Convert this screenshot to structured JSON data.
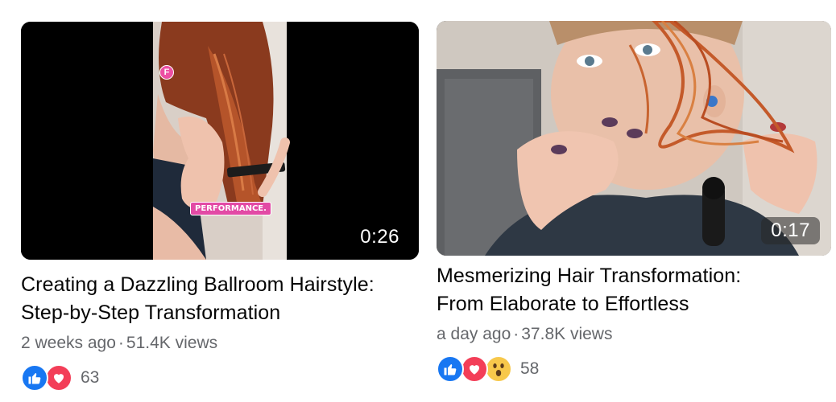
{
  "videos": [
    {
      "duration": "0:26",
      "title_line1": "Creating a Dazzling Ballroom Hairstyle:",
      "title_line2": "Step-by-Step Transformation",
      "age": "2 weeks ago",
      "views": "51.4K views",
      "reaction_icons": [
        "like-icon",
        "love-icon"
      ],
      "reaction_count": "63",
      "overlay_badge": "F",
      "overlay_label": "PERFORMANCE."
    },
    {
      "duration": "0:17",
      "title_line1": "Mesmerizing Hair Transformation:",
      "title_line2": "From Elaborate to Effortless",
      "age": "a day ago",
      "views": "37.8K views",
      "reaction_icons": [
        "like-icon",
        "love-icon",
        "wow-icon"
      ],
      "reaction_count": "58"
    }
  ],
  "separator": "·",
  "colors": {
    "like": "#1877f2",
    "love": "#f33e58",
    "wow": "#f7c84b",
    "meta_text": "#65676b",
    "title_text": "#050505"
  }
}
